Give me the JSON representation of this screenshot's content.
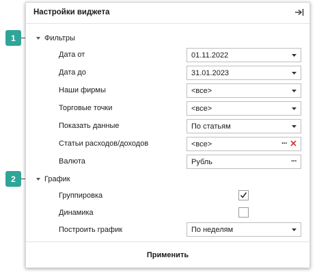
{
  "widget_settings": {
    "title": "Настройки виджета",
    "collapse_icon": "pin-right-icon",
    "sections": [
      {
        "callout": "1",
        "label": "Фильтры",
        "rows": [
          {
            "label": "Дата от",
            "value": "01.11.2022",
            "control": "dropdown"
          },
          {
            "label": "Дата до",
            "value": "31.01.2023",
            "control": "dropdown"
          },
          {
            "label": "Наши фирмы",
            "value": "<все>",
            "control": "dropdown"
          },
          {
            "label": "Торговые точки",
            "value": "<все>",
            "control": "dropdown"
          },
          {
            "label": "Показать данные",
            "value": "По статьям",
            "control": "dropdown"
          },
          {
            "label": "Статьи расходов/доходов",
            "value": "<все>",
            "control": "picker-clear"
          },
          {
            "label": "Валюта",
            "value": "Рубль",
            "control": "picker"
          }
        ]
      },
      {
        "callout": "2",
        "label": "График",
        "rows": [
          {
            "label": "Группировка",
            "checked": true,
            "control": "checkbox"
          },
          {
            "label": "Динамика",
            "checked": false,
            "control": "checkbox"
          },
          {
            "label": "Построить график",
            "value": "По неделям",
            "control": "dropdown"
          }
        ]
      }
    ],
    "apply_label": "Применить"
  },
  "colors": {
    "callout": "#2fa597",
    "clear_icon": "#d9372b"
  }
}
